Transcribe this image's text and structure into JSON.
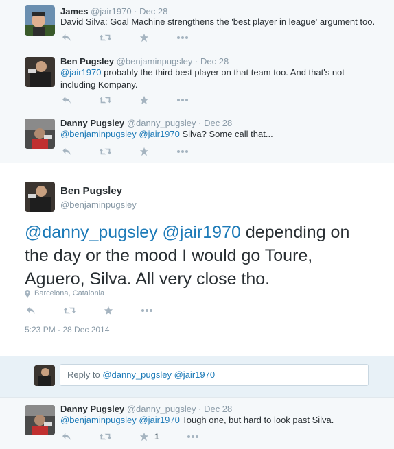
{
  "tweets": [
    {
      "name": "James",
      "handle": "@jair1970",
      "date": "Dec 28",
      "text": "David Silva: Goal Machine strengthens the 'best player in league' argument too.",
      "avatar": "james-avatar"
    },
    {
      "name": "Ben Pugsley",
      "handle": "@benjaminpugsley",
      "date": "Dec 28",
      "mention": "@jair1970",
      "text_line1": "probably the third best player on that team too. And that's not",
      "text_line2": "including Kompany.",
      "avatar": "ben-avatar"
    },
    {
      "name": "Danny Pugsley",
      "handle": "@danny_pugsley",
      "date": "Dec 28",
      "mention1": "@benjaminpugsley",
      "mention2": "@jair1970",
      "text": "Silva? Some call that...",
      "avatar": "danny-avatar"
    }
  ],
  "main_tweet": {
    "name": "Ben Pugsley",
    "handle": "@benjaminpugsley",
    "mention1": "@danny_pugsley",
    "mention2": "@jair1970",
    "text_part1": "depending on",
    "text_line2": "the day or the mood I would go Toure,",
    "text_line3": "Aguero, Silva. All very close tho.",
    "location": "Barcelona, Catalonia",
    "timestamp": "5:23 PM - 28 Dec 2014"
  },
  "reply_box": {
    "prefix": "Reply to",
    "mention1": "@danny_pugsley",
    "mention2": "@jair1970"
  },
  "last_tweet": {
    "name": "Danny Pugsley",
    "handle": "@danny_pugsley",
    "date": "Dec 28",
    "mention1": "@benjaminpugsley",
    "mention2": "@jair1970",
    "text": "Tough one, but hard to look past Silva.",
    "favorite_count": "1"
  },
  "separators": {
    "dot": "·"
  },
  "icons": [
    "reply-icon",
    "retweet-icon",
    "favorite-icon",
    "more-icon",
    "location-pin-icon"
  ],
  "colors": {
    "link": "#1e7bb8",
    "meta": "#8899a6",
    "icon": "#a5b4c0",
    "bg_convo": "#f5f8fa",
    "reply_bg": "#e8f1f7"
  }
}
